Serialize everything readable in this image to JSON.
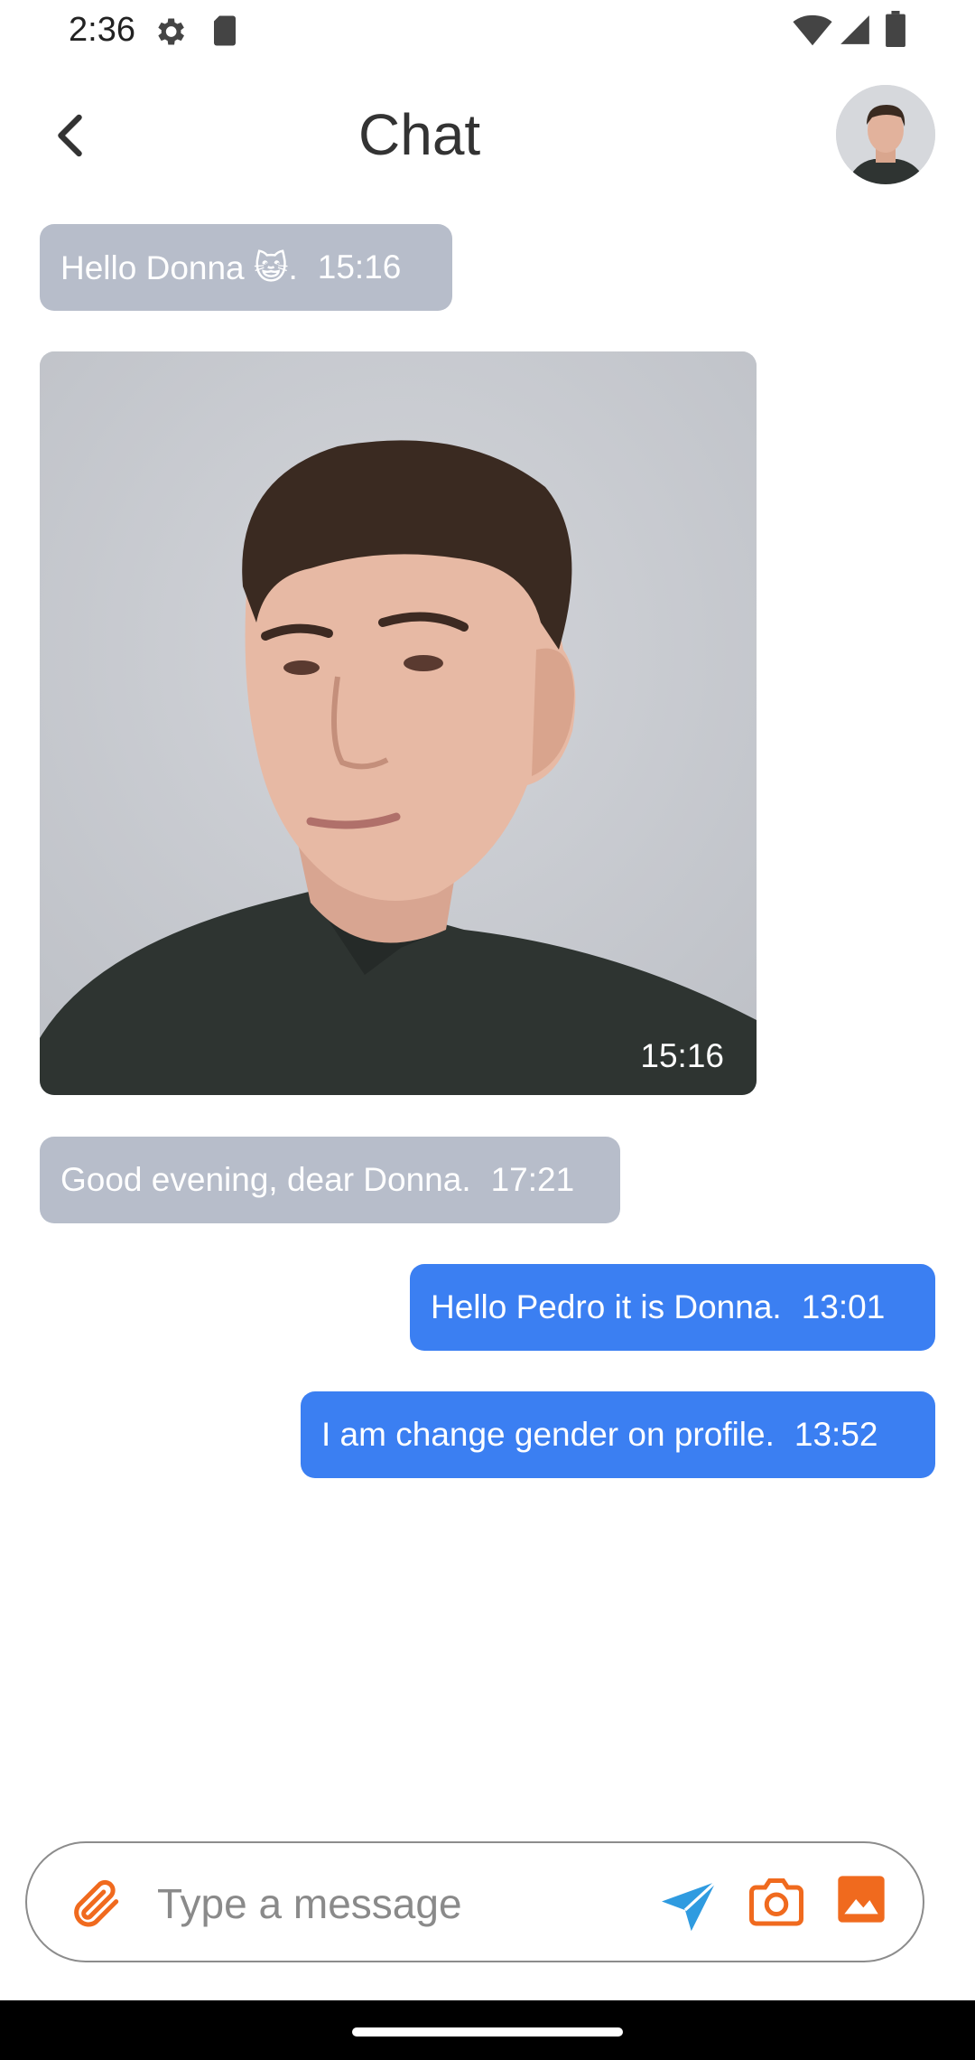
{
  "status_bar": {
    "time": "2:36",
    "icons": [
      "gear-icon",
      "sd-card-icon",
      "wifi-icon",
      "signal-icon",
      "battery-icon"
    ]
  },
  "header": {
    "title": "Chat",
    "icons": [
      "back-arrow-icon",
      "avatar"
    ]
  },
  "messages": [
    {
      "direction": "incoming",
      "text": "Hello Donna 😺.",
      "time": "15:16"
    },
    {
      "direction": "incoming",
      "type": "image",
      "image_description": "portrait photo of a young man",
      "time": "15:16"
    },
    {
      "direction": "incoming",
      "text": "Good evening, dear Donna.",
      "time": "17:21"
    },
    {
      "direction": "outgoing",
      "text": "Hello Pedro it is Donna.",
      "time": "13:01"
    },
    {
      "direction": "outgoing",
      "text": "I am change gender on profile.",
      "time": "13:52"
    }
  ],
  "composer": {
    "placeholder": "Type a message",
    "value": "",
    "icons": [
      "paperclip-icon",
      "send-icon",
      "camera-icon",
      "gallery-icon"
    ]
  },
  "colors": {
    "incoming_bubble": "#b7bdca",
    "outgoing_bubble": "#3b7ff2",
    "accent_orange": "#f06a1e",
    "send_blue": "#2f9be0"
  }
}
